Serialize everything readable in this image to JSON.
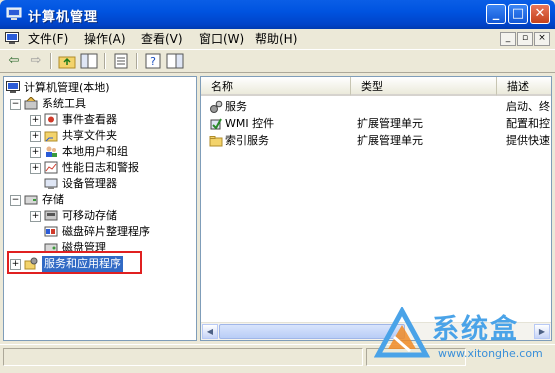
{
  "window": {
    "title": "计算机管理"
  },
  "menu": [
    {
      "label": "文件(F)"
    },
    {
      "label": "操作(A)"
    },
    {
      "label": "查看(V)"
    },
    {
      "label": "窗口(W)"
    },
    {
      "label": "帮助(H)"
    }
  ],
  "tree": [
    {
      "label": "计算机管理(本地)",
      "icon": "computer-icon"
    },
    {
      "label": "系统工具",
      "icon": "tools-icon"
    },
    {
      "label": "事件查看器",
      "icon": "event-viewer-icon"
    },
    {
      "label": "共享文件夹",
      "icon": "shared-folder-icon"
    },
    {
      "label": "本地用户和组",
      "icon": "users-icon"
    },
    {
      "label": "性能日志和警报",
      "icon": "performance-icon"
    },
    {
      "label": "设备管理器",
      "icon": "device-manager-icon"
    },
    {
      "label": "存储",
      "icon": "storage-icon"
    },
    {
      "label": "可移动存储",
      "icon": "removable-storage-icon"
    },
    {
      "label": "磁盘碎片整理程序",
      "icon": "defrag-icon"
    },
    {
      "label": "磁盘管理",
      "icon": "disk-management-icon"
    },
    {
      "label": "服务和应用程序",
      "icon": "services-apps-icon",
      "selected": true
    }
  ],
  "list": {
    "columns": [
      "名称",
      "类型",
      "描述"
    ],
    "rows": [
      {
        "name": "服务",
        "type": "",
        "desc": "启动、终",
        "icon": "gears-icon"
      },
      {
        "name": "WMI 控件",
        "type": "扩展管理单元",
        "desc": "配置和控",
        "icon": "wmi-icon"
      },
      {
        "name": "索引服务",
        "type": "扩展管理单元",
        "desc": "提供快速",
        "icon": "folder-icon"
      }
    ]
  },
  "watermark": {
    "text": "系统盒",
    "url": "www.xitonghe.com"
  },
  "colors": {
    "titlebar": "#0053e0",
    "selection": "#316ac5",
    "highlight_box": "#e02020",
    "watermark": "#4aa3e8"
  }
}
